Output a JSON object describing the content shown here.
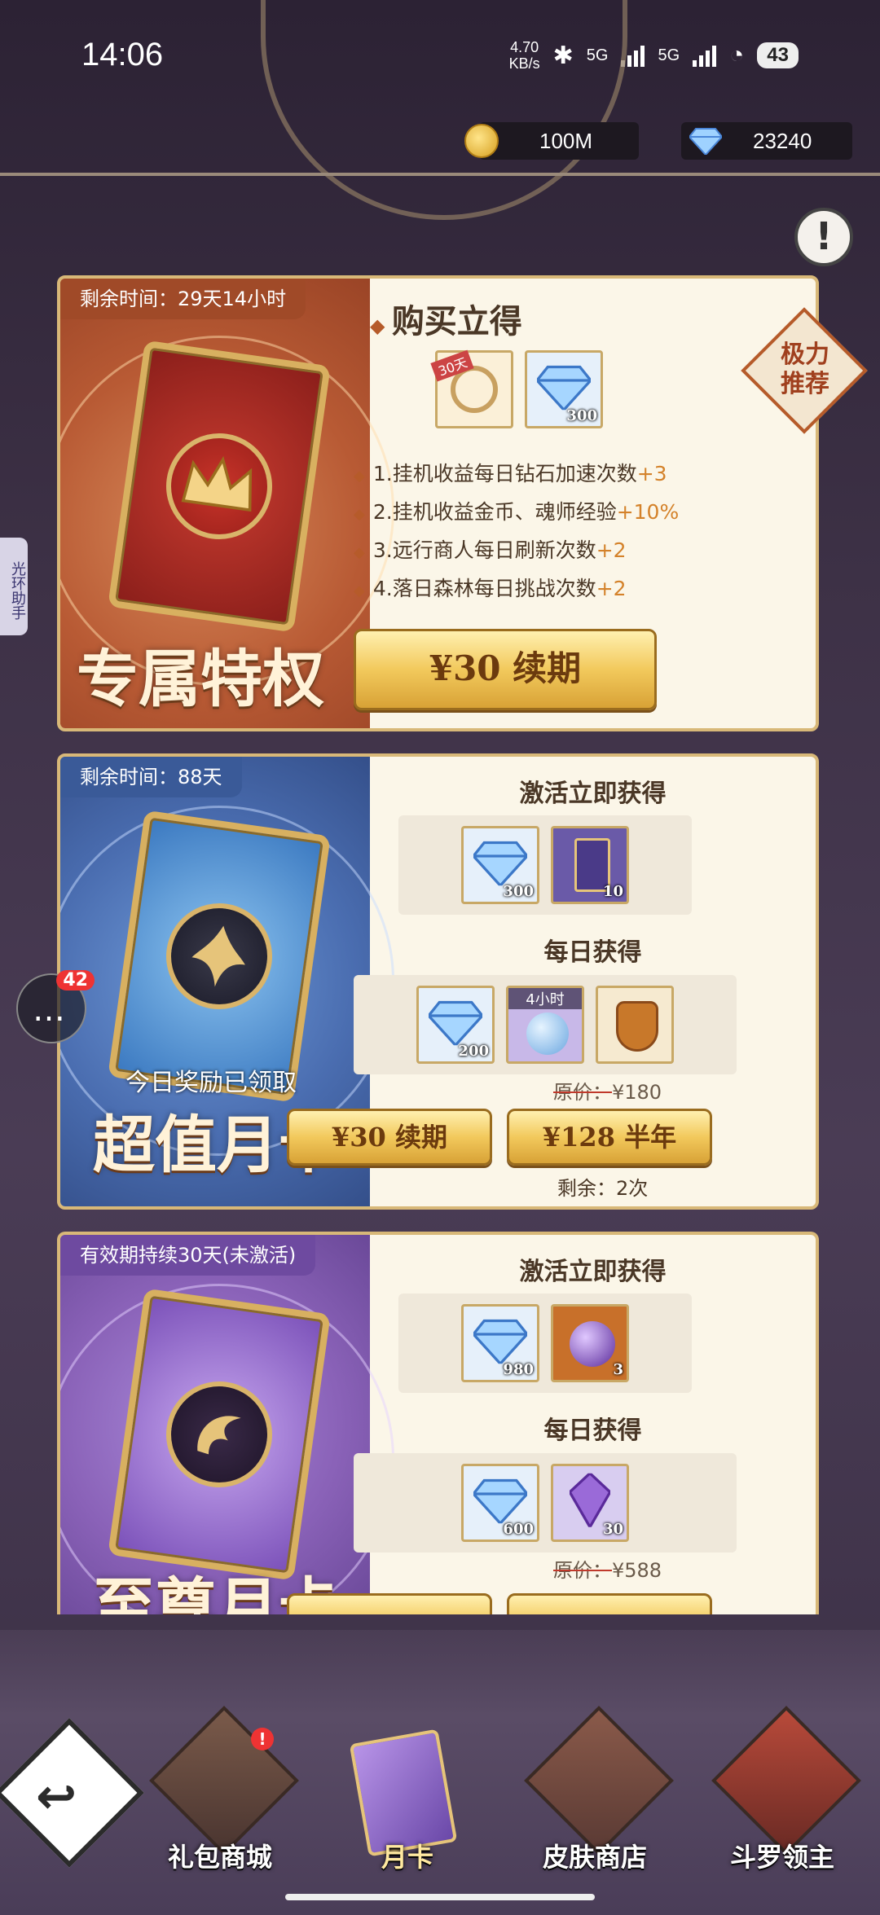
{
  "status_bar": {
    "time": "14:06",
    "net_speed": "4.70",
    "net_unit": "KB/s",
    "sig1": "5G",
    "sig2": "5G",
    "battery": "43"
  },
  "currency": {
    "coins": "100M",
    "gems": "23240"
  },
  "info_button": "!",
  "side_tab": "光环助手",
  "chat": {
    "count": "42"
  },
  "privilege_card": {
    "timer": "剩余时间：29天14小时",
    "title": "专属特权卡",
    "ribbon": "极力推荐",
    "section": "购买立得",
    "items": [
      {
        "icon": "ring-icon",
        "tag": "30天",
        "count": ""
      },
      {
        "icon": "diamond-icon",
        "tag": "",
        "count": "300"
      }
    ],
    "benefits": [
      {
        "text": "1.挂机收益每日钻石加速次数",
        "hl": "+3"
      },
      {
        "text": "2.挂机收益金币、魂师经验",
        "hl": "+10%"
      },
      {
        "text": "3.远行商人每日刷新次数",
        "hl": "+2"
      },
      {
        "text": "4.落日森林每日挑战次数",
        "hl": "+2"
      }
    ],
    "button": "¥30 续期"
  },
  "value_card": {
    "timer": "剩余时间：88天",
    "title": "超值月卡",
    "claimed": "今日奖励已领取",
    "activate_title": "激活立即获得",
    "activate_items": [
      {
        "icon": "diamond-icon",
        "count": "300"
      },
      {
        "icon": "card-icon",
        "count": "10"
      }
    ],
    "daily_title": "每日获得",
    "daily_items": [
      {
        "icon": "diamond-icon",
        "count": "200",
        "tag": ""
      },
      {
        "icon": "potion-icon",
        "count": "",
        "tag": "4小时"
      },
      {
        "icon": "shield-icon",
        "count": "",
        "tag": ""
      }
    ],
    "orig_label": "原价：",
    "orig_price": "¥180",
    "button1": "¥30 续期",
    "button2": "¥128 半年",
    "remaining": "剩余：2次"
  },
  "supreme_card": {
    "timer": "有效期持续30天(未激活)",
    "title": "至尊月卡",
    "activate_title": "激活立即获得",
    "activate_items": [
      {
        "icon": "diamond-icon",
        "count": "980"
      },
      {
        "icon": "orb-icon",
        "count": "3"
      }
    ],
    "daily_title": "每日获得",
    "daily_items": [
      {
        "icon": "diamond-icon",
        "count": "600"
      },
      {
        "icon": "crystal-icon",
        "count": "30"
      }
    ],
    "orig_label": "原价：",
    "orig_price": "¥588"
  },
  "nav": {
    "gift": "礼包商城",
    "monthly": "月卡",
    "skin": "皮肤商店",
    "lord": "斗罗领主",
    "gift_badge": "!"
  },
  "colors": {
    "gold": "#f2c95c",
    "red_panel": "#b85a34",
    "blue_panel": "#4a6db0",
    "purple_panel": "#8a62b8"
  }
}
